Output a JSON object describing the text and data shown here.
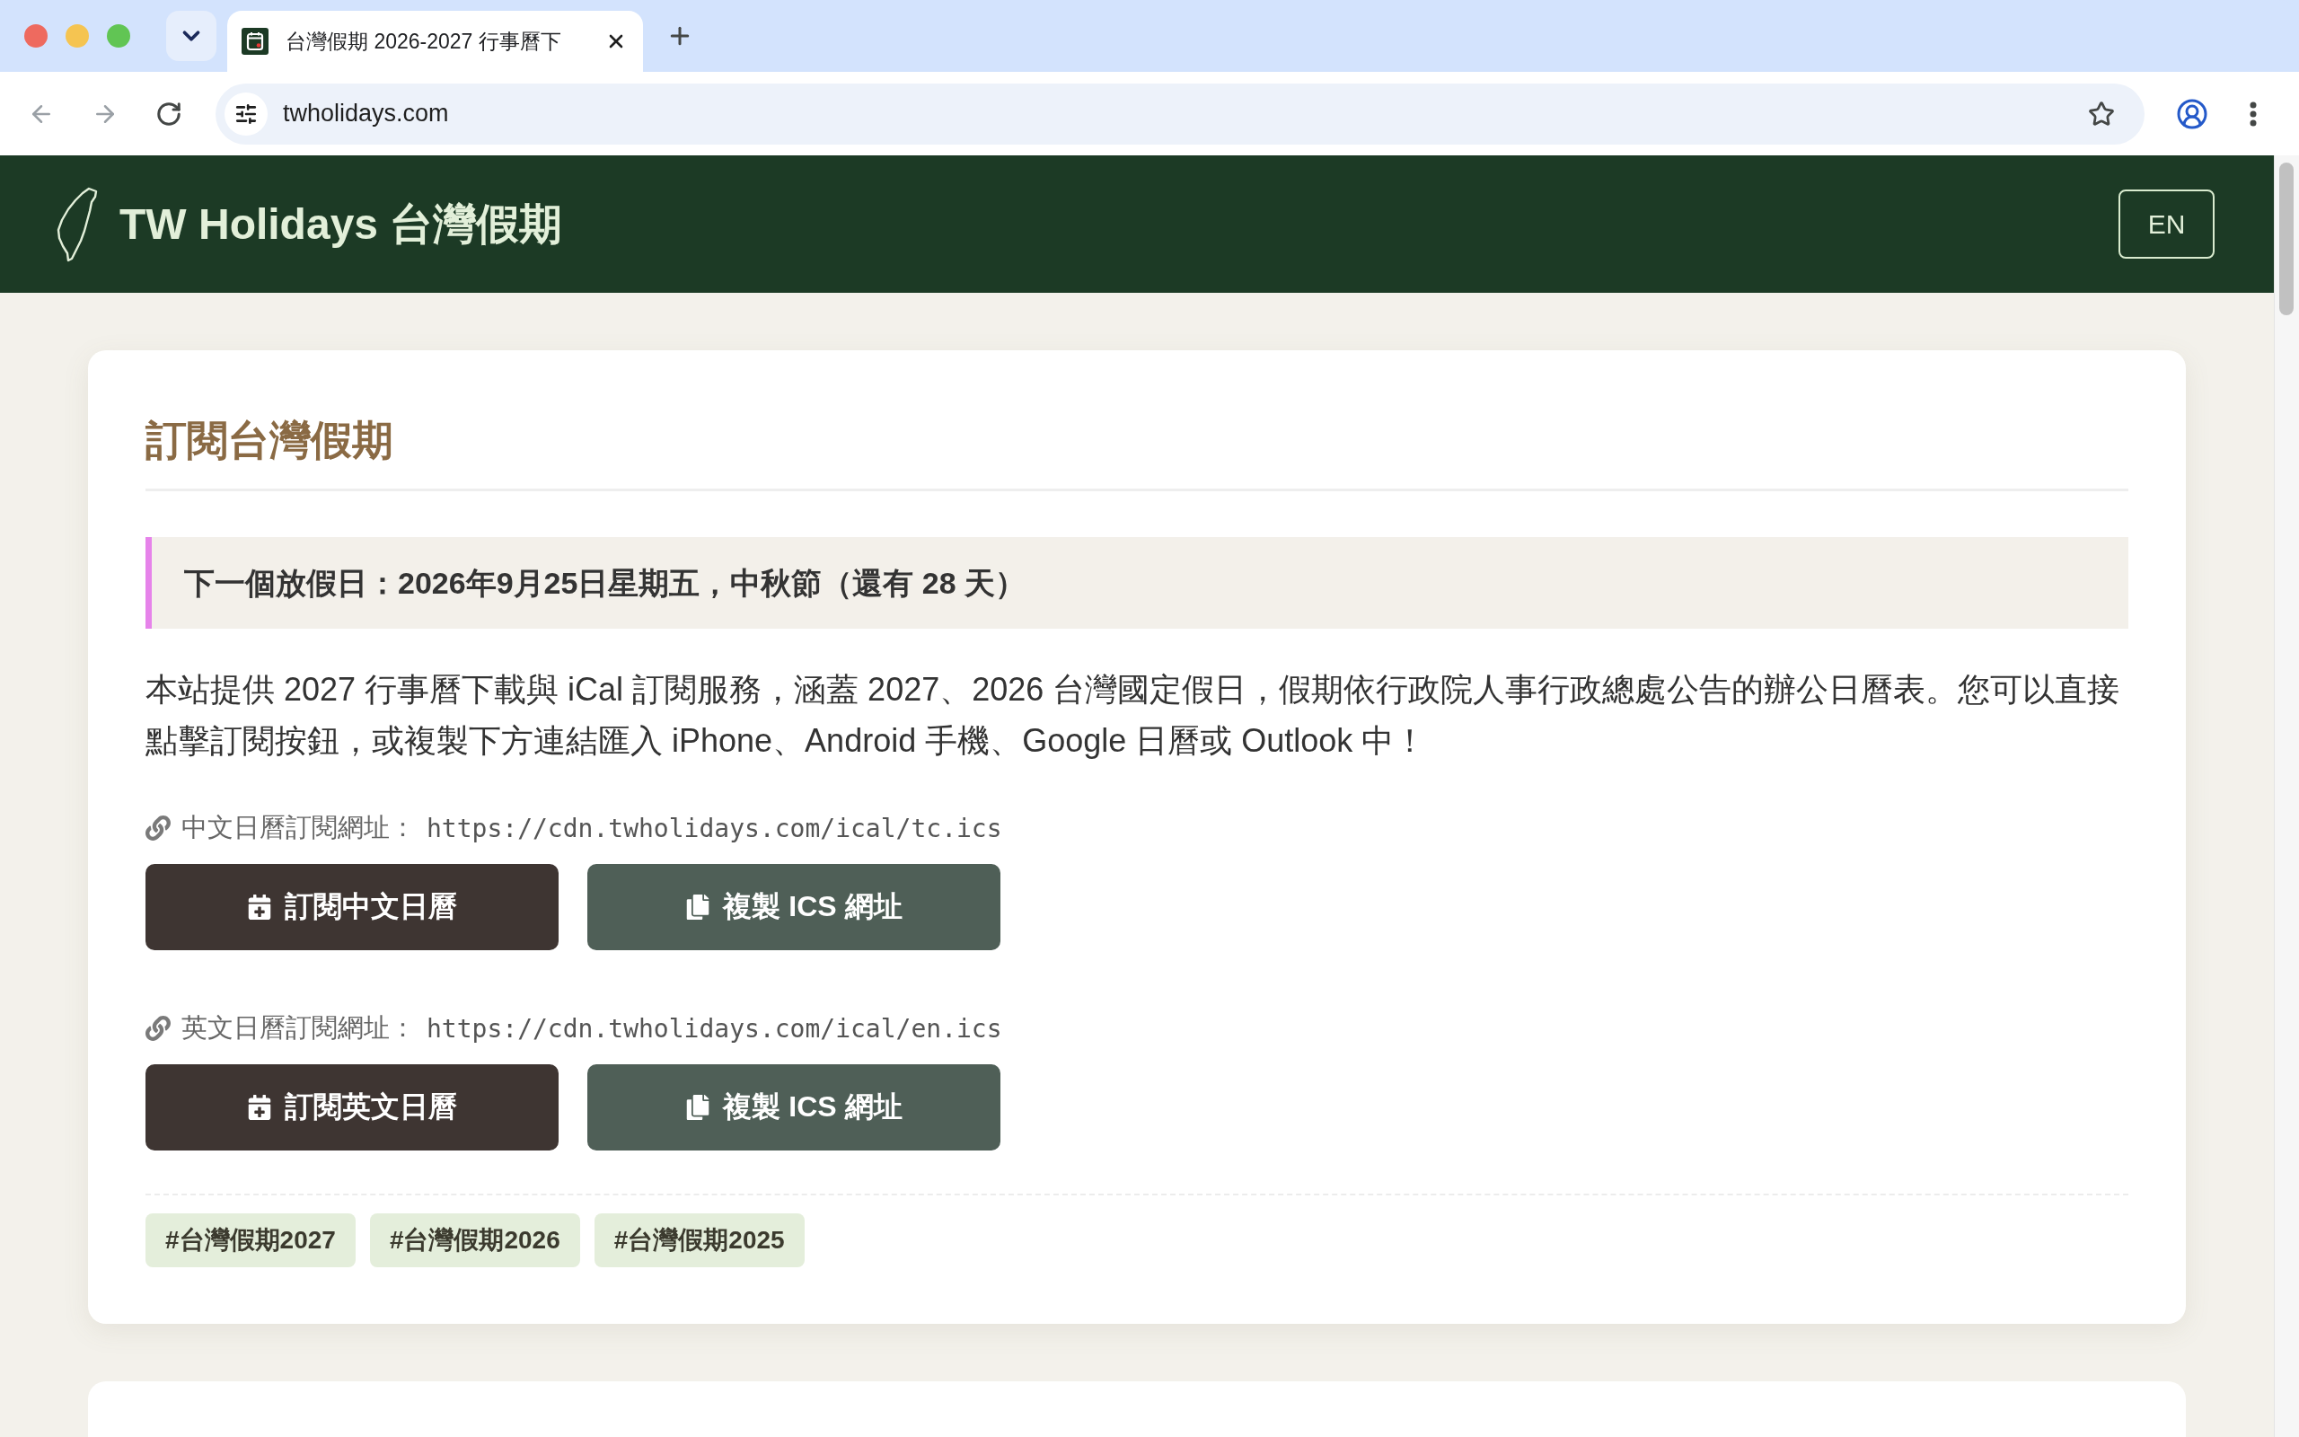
{
  "browser": {
    "tabs": [
      {
        "title": "台灣假期 2026-2027 行事曆下",
        "selected": true
      }
    ],
    "address": "twholidays.com"
  },
  "header": {
    "title": "TW Holidays 台灣假期",
    "language_button": "EN"
  },
  "subscribe_card": {
    "heading": "訂閱台灣假期",
    "next_holiday": "下一個放假日：2026年9月25日星期五，中秋節（還有 28 天）",
    "description": "本站提供 2027 行事曆下載與 iCal 訂閱服務，涵蓋 2027、2026 台灣國定假日，假期依行政院人事行政總處公告的辦公日曆表。您可以直接點擊訂閱按鈕，或複製下方連結匯入 iPhone、Android 手機、Google 日曆或 Outlook 中！",
    "subscriptions": [
      {
        "label": "中文日曆訂閱網址：",
        "url": "https://cdn.twholidays.com/ical/tc.ics",
        "subscribe_button": "訂閱中文日曆",
        "copy_button": "複製 ICS 網址"
      },
      {
        "label": "英文日曆訂閱網址：",
        "url": "https://cdn.twholidays.com/ical/en.ics",
        "subscribe_button": "訂閱英文日曆",
        "copy_button": "複製 ICS 網址"
      }
    ],
    "tags": [
      "#台灣假期2027",
      "#台灣假期2026",
      "#台灣假期2025"
    ]
  }
}
